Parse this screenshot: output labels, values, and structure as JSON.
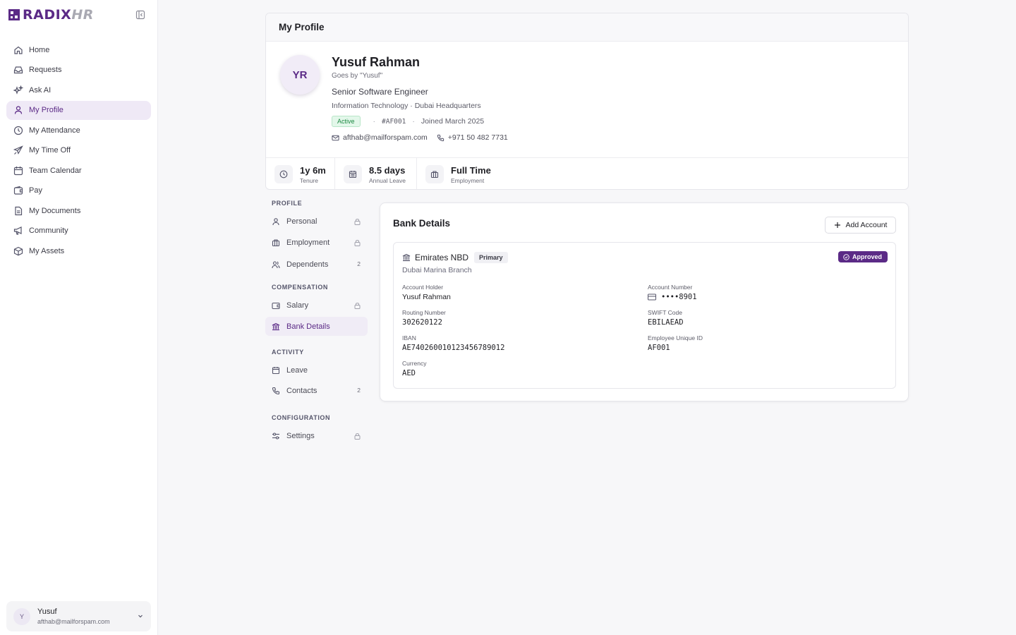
{
  "brand": {
    "name_main": "RADIX",
    "name_accent": "HR",
    "color": "#5b2a86"
  },
  "sidebar": {
    "items": [
      {
        "label": "Home",
        "icon": "home-icon"
      },
      {
        "label": "Requests",
        "icon": "inbox-icon"
      },
      {
        "label": "Ask AI",
        "icon": "sparkles-icon"
      },
      {
        "label": "My Profile",
        "icon": "user-icon",
        "active": true
      },
      {
        "label": "My Attendance",
        "icon": "clock-icon"
      },
      {
        "label": "My Time Off",
        "icon": "plane-icon"
      },
      {
        "label": "Team Calendar",
        "icon": "calendar-icon"
      },
      {
        "label": "Pay",
        "icon": "wallet-icon"
      },
      {
        "label": "My Documents",
        "icon": "document-icon"
      },
      {
        "label": "Community",
        "icon": "megaphone-icon"
      },
      {
        "label": "My Assets",
        "icon": "box-icon"
      }
    ],
    "user": {
      "initial": "Y",
      "name": "Yusuf",
      "email": "afthab@mailforspam.com"
    }
  },
  "profile": {
    "header_title": "My Profile",
    "initials": "YR",
    "name": "Yusuf Rahman",
    "goes_by": "Goes by \"Yusuf\"",
    "title": "Senior Software Engineer",
    "dept_location": "Information Technology · Dubai Headquarters",
    "status": "Active",
    "employee_code": "#AF001",
    "joined": "Joined March 2025",
    "email": "afthab@mailforspam.com",
    "phone": "+971 50 482 7731",
    "stats": [
      {
        "value": "1y 6m",
        "label": "Tenure",
        "icon": "clock-icon"
      },
      {
        "value": "8.5 days",
        "label": "Annual Leave",
        "icon": "calendar-icon"
      },
      {
        "value": "Full Time",
        "label": "Employment",
        "icon": "briefcase-icon"
      }
    ]
  },
  "subnav": {
    "sections": [
      {
        "title": "PROFILE",
        "items": [
          {
            "label": "Personal",
            "icon": "user-icon",
            "locked": true
          },
          {
            "label": "Employment",
            "icon": "briefcase-icon",
            "locked": true
          },
          {
            "label": "Dependents",
            "icon": "users-icon",
            "count": "2"
          }
        ]
      },
      {
        "title": "COMPENSATION",
        "items": [
          {
            "label": "Salary",
            "icon": "wallet-icon",
            "locked": true
          },
          {
            "label": "Bank Details",
            "icon": "bank-icon",
            "active": true
          }
        ]
      },
      {
        "title": "ACTIVITY",
        "items": [
          {
            "label": "Leave",
            "icon": "calendar-icon"
          },
          {
            "label": "Contacts",
            "icon": "phone-icon",
            "count": "2"
          }
        ]
      },
      {
        "title": "CONFIGURATION",
        "items": [
          {
            "label": "Settings",
            "icon": "sliders-icon",
            "locked": true
          }
        ]
      }
    ]
  },
  "bank": {
    "title": "Bank Details",
    "add_label": "Add Account",
    "account": {
      "bank_name": "Emirates NBD",
      "primary_label": "Primary",
      "branch": "Dubai Marina Branch",
      "status": "Approved",
      "fields": {
        "holder_label": "Account Holder",
        "holder": "Yusuf Rahman",
        "number_label": "Account Number",
        "number": "••••8901",
        "routing_label": "Routing Number",
        "routing": "302620122",
        "swift_label": "SWIFT Code",
        "swift": "EBILAEAD",
        "iban_label": "IBAN",
        "iban": "AE740260010123456789012",
        "euid_label": "Employee Unique ID",
        "euid": "AF001",
        "currency_label": "Currency",
        "currency": "AED"
      }
    }
  }
}
